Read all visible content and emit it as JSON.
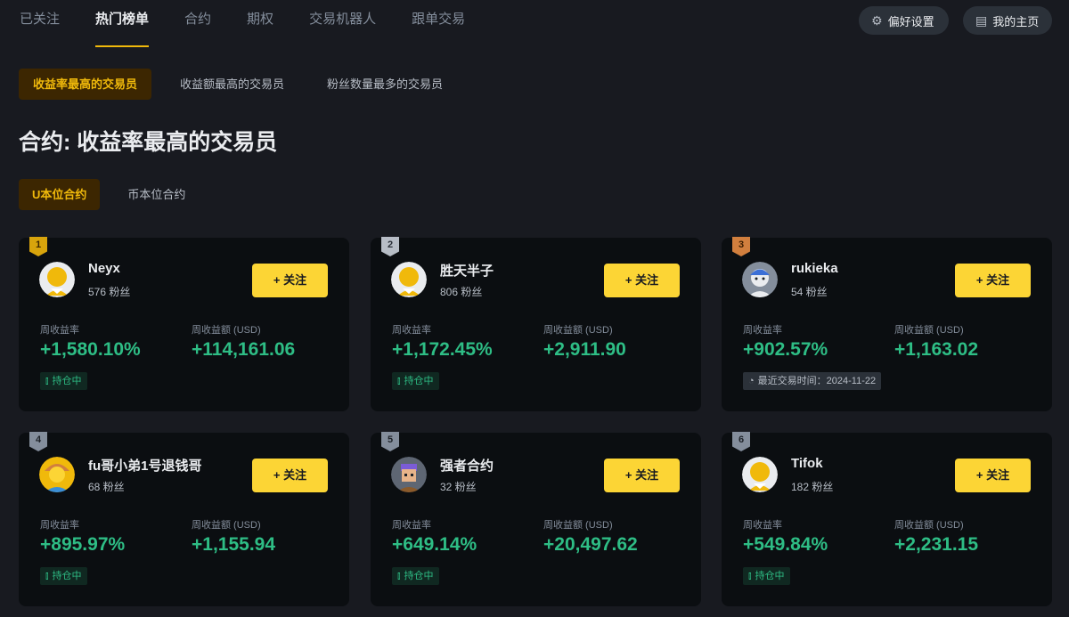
{
  "nav": {
    "tabs": [
      "已关注",
      "热门榜单",
      "合约",
      "期权",
      "交易机器人",
      "跟单交易"
    ],
    "active_tab": "热门榜单",
    "preferences_label": "偏好设置",
    "homepage_label": "我的主页"
  },
  "filters": {
    "items": [
      "收益率最高的交易员",
      "收益额最高的交易员",
      "粉丝数量最多的交易员"
    ],
    "active": "收益率最高的交易员"
  },
  "page_title": "合约: 收益率最高的交易员",
  "contract_types": {
    "items": [
      "U本位合约",
      "币本位合约"
    ],
    "active": "U本位合约"
  },
  "card_labels": {
    "follow": "+ 关注",
    "weekly_roi": "周收益率",
    "weekly_pnl": "周收益额 (USD)"
  },
  "traders": [
    {
      "rank": "1",
      "name": "Neyx",
      "fans": "576 粉丝",
      "roi": "+1,580.10%",
      "pnl": "+114,161.06",
      "status": "持仓中"
    },
    {
      "rank": "2",
      "name": "胜天半子",
      "fans": "806 粉丝",
      "roi": "+1,172.45%",
      "pnl": "+2,911.90",
      "status": "持仓中"
    },
    {
      "rank": "3",
      "name": "rukieka",
      "fans": "54 粉丝",
      "roi": "+902.57%",
      "pnl": "+1,163.02",
      "status": "最近交易时间：2024-11-22"
    },
    {
      "rank": "4",
      "name": "fu哥小弟1号退钱哥",
      "fans": "68 粉丝",
      "roi": "+895.97%",
      "pnl": "+1,155.94",
      "status": "持仓中"
    },
    {
      "rank": "5",
      "name": "强者合约",
      "fans": "32 粉丝",
      "roi": "+649.14%",
      "pnl": "+20,497.62",
      "status": "持仓中"
    },
    {
      "rank": "6",
      "name": "Tifok",
      "fans": "182 粉丝",
      "roi": "+549.84%",
      "pnl": "+2,231.15",
      "status": "持仓中"
    }
  ],
  "colors": {
    "accent": "#fcd535",
    "gain": "#2ebd85",
    "background": "#181a20",
    "card": "#0b0e11"
  }
}
